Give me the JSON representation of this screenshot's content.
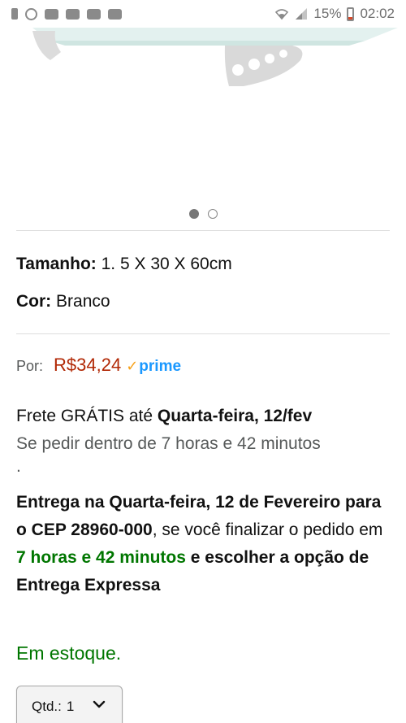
{
  "status_bar": {
    "battery": "15%",
    "time": "02:02",
    "icons": [
      "notification-icon",
      "whatsapp-icon",
      "youtube-icon",
      "youtube-icon",
      "youtube-icon",
      "youtube-icon",
      "wifi-icon",
      "signal-icon",
      "battery-icon"
    ]
  },
  "carousel": {
    "count": 2,
    "active_index": 0
  },
  "attributes": {
    "size_label": "Tamanho:",
    "size_value": "1. 5 X 30 X 60cm",
    "color_label": "Cor:",
    "color_value": "Branco"
  },
  "price": {
    "label": "Por:",
    "value": "R$34,24",
    "prime_check": "✓",
    "prime_text": "prime"
  },
  "delivery": {
    "free_shipping": "Frete GRÁTIS até",
    "free_shipping_date": "Quarta-feira, 12/fev",
    "order_within": "Se pedir dentro de 7 horas e 42 minutos",
    "order_within_dot": ".",
    "express_bold_1": "Entrega na Quarta-feira, 12 de Fevereiro para o CEP 28960-000",
    "express_text_1": ", se você finalizar o pedido em",
    "express_green": "7 horas e 42 minutos",
    "express_bold_2": "e escolher a opção de Entrega Expressa"
  },
  "stock": "Em estoque.",
  "quantity": {
    "label": "Qtd.:",
    "value": "1"
  },
  "colors": {
    "price": "#b12704",
    "green": "#007600",
    "prime": "#1a98ff",
    "prime_check": "#f7a21b"
  }
}
